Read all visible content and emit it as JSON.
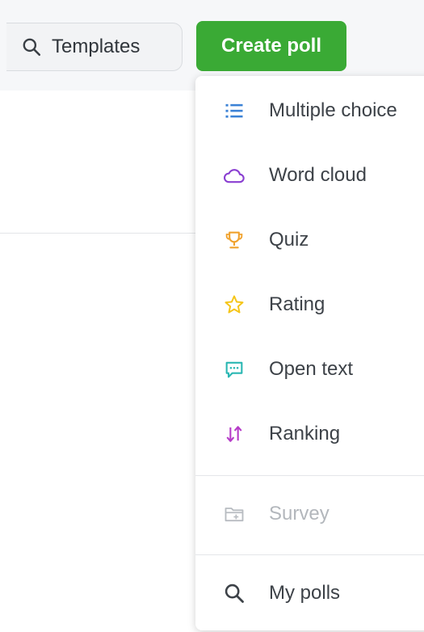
{
  "header": {
    "templates_label": "Templates",
    "create_poll_label": "Create poll"
  },
  "menu": {
    "items": [
      {
        "label": "Multiple choice",
        "icon": "list-icon",
        "color": "#3b82d6"
      },
      {
        "label": "Word cloud",
        "icon": "cloud-icon",
        "color": "#8a3fd1"
      },
      {
        "label": "Quiz",
        "icon": "trophy-icon",
        "color": "#f0a22e"
      },
      {
        "label": "Rating",
        "icon": "star-icon",
        "color": "#f5c518"
      },
      {
        "label": "Open text",
        "icon": "speech-bubble-icon",
        "color": "#2bb7b3"
      },
      {
        "label": "Ranking",
        "icon": "sort-arrows-icon",
        "color": "#b63cc8"
      },
      {
        "label": "Survey",
        "icon": "folder-plus-icon",
        "color": "#b8bcc1",
        "disabled": true
      },
      {
        "label": "My polls",
        "icon": "search-icon",
        "color": "#3d4248"
      }
    ]
  },
  "colors": {
    "create_button": "#3aaa35",
    "topbar_background": "#f6f7f9"
  }
}
